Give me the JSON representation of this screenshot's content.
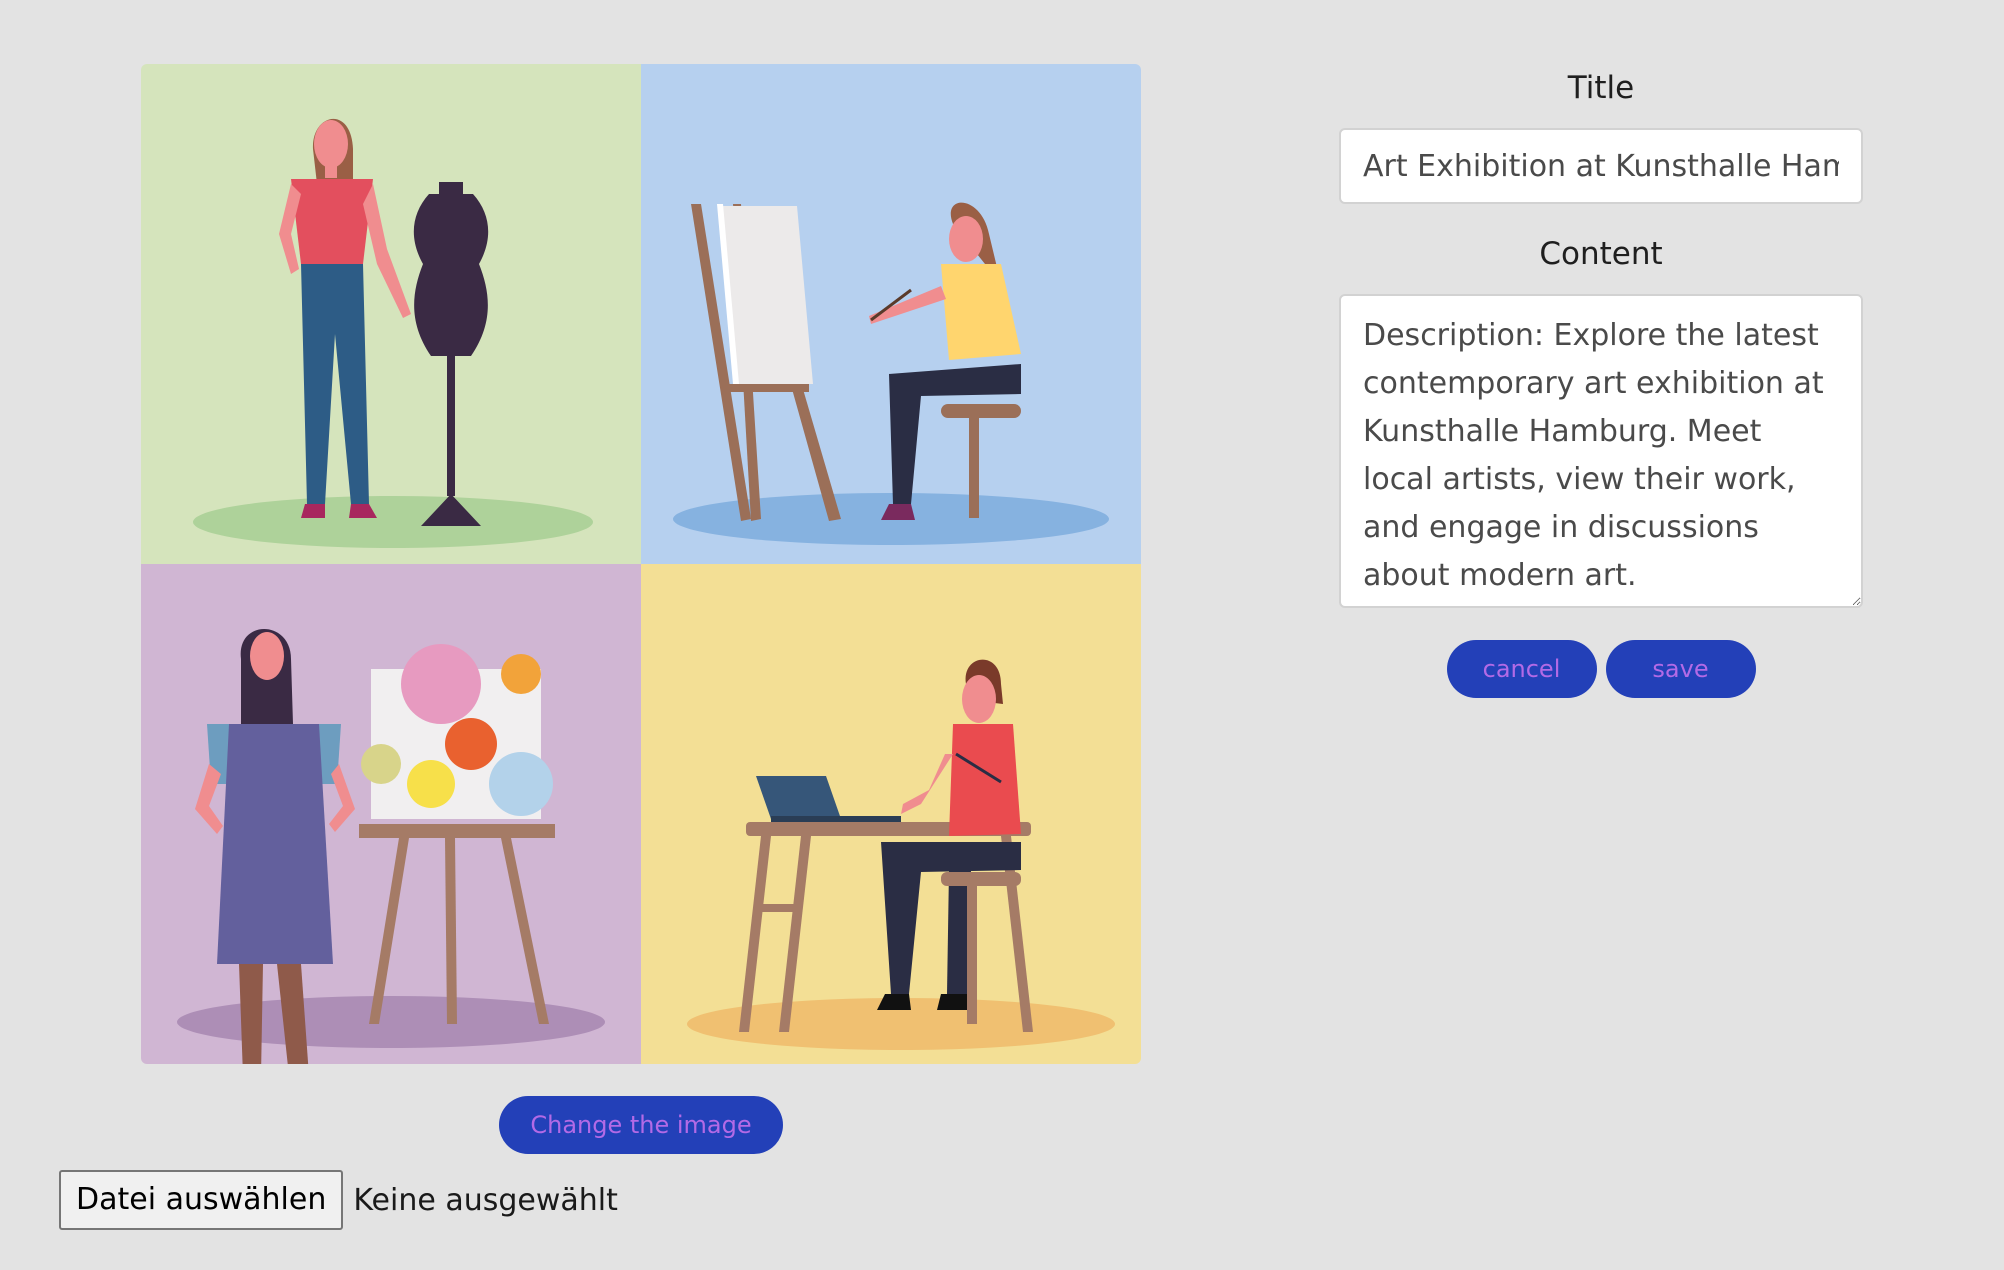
{
  "image": {
    "alt": "",
    "change_button_label": "Change the image"
  },
  "file_input": {
    "button_label": "Datei auswählen",
    "status_text": "Keine ausgewählt"
  },
  "form": {
    "title_label": "Title",
    "title_value": "Art Exhibition at Kunsthalle Hamburg",
    "content_label": "Content",
    "content_value": "Description: Explore the latest contemporary art exhibition at Kunsthalle Hamburg. Meet local artists, view their work, and engage in discussions about modern art.",
    "cancel_label": "cancel",
    "save_label": "save"
  },
  "colors": {
    "page_background": "#e3e3e3",
    "button_background": "#2340b8",
    "button_text": "#b36ae6",
    "panel_green": "#d5e4bc",
    "panel_blue": "#b6d0ef",
    "panel_purple": "#d0b6d3",
    "panel_yellow": "#f3df95"
  },
  "icons": {
    "resize_handle": "resize-grip-icon"
  }
}
